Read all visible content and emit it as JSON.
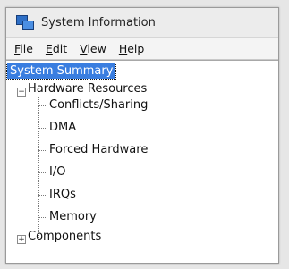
{
  "window": {
    "title": "System Information",
    "icon": "system-information-icon"
  },
  "menubar": {
    "items": [
      {
        "label": "File",
        "mnemonic": "F",
        "rest": "ile"
      },
      {
        "label": "Edit",
        "mnemonic": "E",
        "rest": "dit"
      },
      {
        "label": "View",
        "mnemonic": "V",
        "rest": "iew"
      },
      {
        "label": "Help",
        "mnemonic": "H",
        "rest": "elp"
      }
    ]
  },
  "tree": {
    "root": "System Summary",
    "hardware": {
      "label": "Hardware Resources",
      "expander": "−",
      "children": [
        "Conflicts/Sharing",
        "DMA",
        "Forced Hardware",
        "I/O",
        "IRQs",
        "Memory"
      ]
    },
    "components": {
      "label": "Components",
      "expander": "+"
    }
  },
  "colors": {
    "selection": "#3a7ee0",
    "selection_text": "#ffffff"
  }
}
